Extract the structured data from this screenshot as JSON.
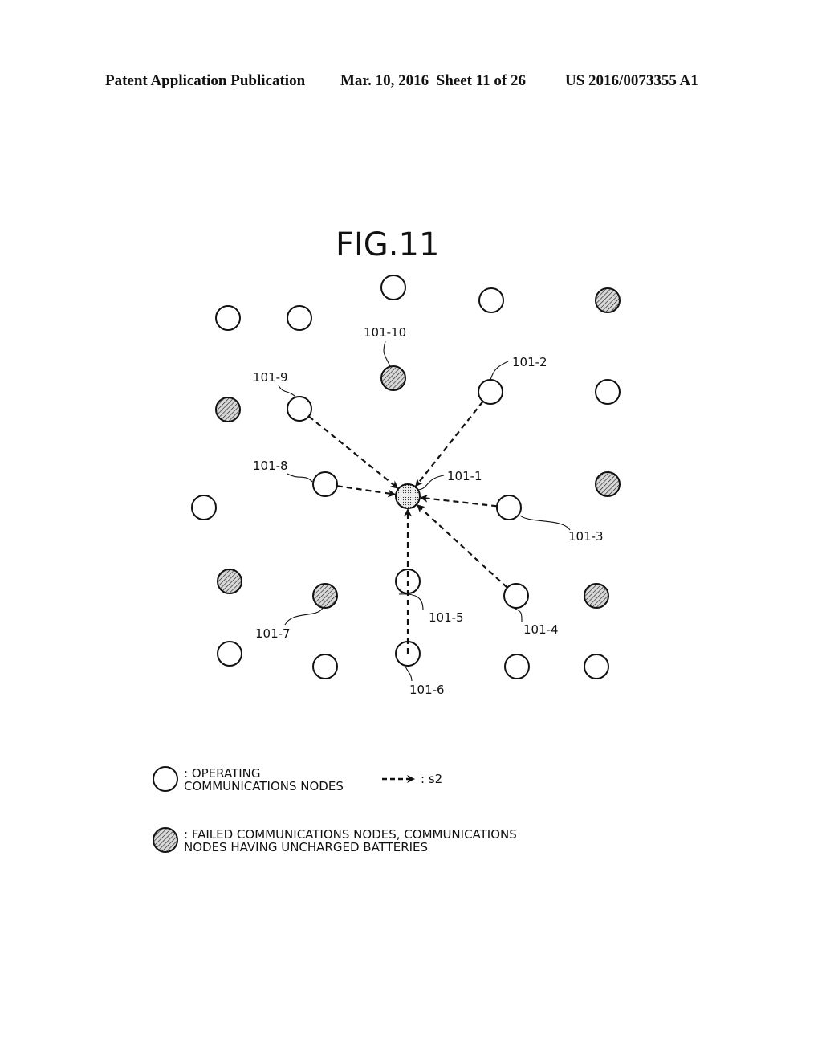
{
  "header": {
    "publication": "Patent Application Publication",
    "date_sheet": "Mar. 10, 2016  Sheet 11 of 26",
    "number": "US 2016/0073355 A1"
  },
  "figure": {
    "title": "FIG.11",
    "nodes": [
      {
        "id": "n-a",
        "type": "operating",
        "label": ""
      },
      {
        "id": "n-b",
        "type": "operating",
        "label": ""
      },
      {
        "id": "n-c",
        "type": "operating",
        "label": ""
      },
      {
        "id": "n-d",
        "type": "operating",
        "label": ""
      },
      {
        "id": "n-e",
        "type": "failed",
        "label": ""
      },
      {
        "id": "101-10",
        "type": "failed",
        "label": "101-10"
      },
      {
        "id": "101-9",
        "type": "operating",
        "label": "101-9"
      },
      {
        "id": "101-2",
        "type": "operating",
        "label": "101-2"
      },
      {
        "id": "n-f",
        "type": "failed",
        "label": ""
      },
      {
        "id": "n-g",
        "type": "operating",
        "label": ""
      },
      {
        "id": "101-8",
        "type": "operating",
        "label": "101-8"
      },
      {
        "id": "101-1",
        "type": "target",
        "label": "101-1"
      },
      {
        "id": "101-3",
        "type": "operating",
        "label": "101-3"
      },
      {
        "id": "n-h",
        "type": "failed",
        "label": ""
      },
      {
        "id": "n-i",
        "type": "operating",
        "label": ""
      },
      {
        "id": "n-j",
        "type": "failed",
        "label": ""
      },
      {
        "id": "101-7",
        "type": "failed",
        "label": "101-7"
      },
      {
        "id": "101-5",
        "type": "operating",
        "label": "101-5"
      },
      {
        "id": "101-4",
        "type": "operating",
        "label": "101-4"
      },
      {
        "id": "n-k",
        "type": "failed",
        "label": ""
      },
      {
        "id": "n-l",
        "type": "operating",
        "label": ""
      },
      {
        "id": "n-m",
        "type": "operating",
        "label": ""
      },
      {
        "id": "101-6",
        "type": "operating",
        "label": "101-6"
      },
      {
        "id": "n-n",
        "type": "operating",
        "label": ""
      },
      {
        "id": "n-o",
        "type": "operating",
        "label": ""
      }
    ],
    "edges": [
      {
        "from": "101-9",
        "to": "101-1",
        "kind": "s2"
      },
      {
        "from": "101-2",
        "to": "101-1",
        "kind": "s2"
      },
      {
        "from": "101-8",
        "to": "101-1",
        "kind": "s2"
      },
      {
        "from": "101-3",
        "to": "101-1",
        "kind": "s2"
      },
      {
        "from": "101-4",
        "to": "101-1",
        "kind": "s2"
      },
      {
        "from": "101-6",
        "to": "101-1",
        "kind": "s2"
      }
    ]
  },
  "legend": {
    "operating_line1": ": OPERATING",
    "operating_line2": "COMMUNICATIONS NODES",
    "arrow_label": ": s2",
    "failed_line1": ": FAILED COMMUNICATIONS NODES, COMMUNICATIONS",
    "failed_line2": "NODES HAVING UNCHARGED BATTERIES"
  },
  "colors": {
    "ink": "#111111",
    "hatch_bg": "#d8d8d8",
    "dot_bg": "#e6e6e6"
  }
}
